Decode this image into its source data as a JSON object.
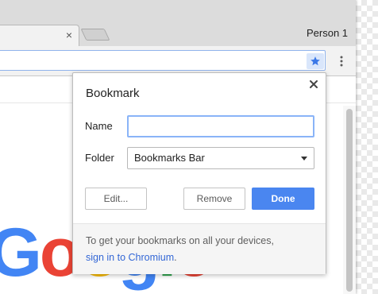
{
  "window": {
    "profile_name": "Person 1",
    "tab_close_glyph": "×"
  },
  "toolbar": {
    "bookmark_star_active": true,
    "accent_color": "#4a86f0"
  },
  "page": {
    "logo_letters": [
      "G",
      "o",
      "o",
      "g",
      "l",
      "e"
    ],
    "logo_colors": [
      "#4285f4",
      "#ea4335",
      "#fbbc05",
      "#4285f4",
      "#34a853",
      "#ea4335"
    ]
  },
  "bookmark_bubble": {
    "title": "Bookmark",
    "close_glyph": "✕",
    "name_label": "Name",
    "name_value": "",
    "folder_label": "Folder",
    "folder_selected": "Bookmarks Bar",
    "edit_button": "Edit...",
    "remove_button": "Remove",
    "done_button": "Done",
    "promo_text_prefix": "To get your bookmarks on all your devices,",
    "promo_link": "sign in to Chromium",
    "promo_text_suffix": "."
  }
}
